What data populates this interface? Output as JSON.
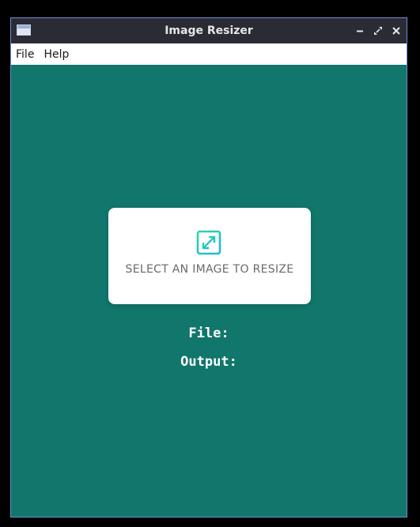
{
  "window": {
    "title": "Image Resizer"
  },
  "menubar": {
    "items": [
      {
        "label": "File"
      },
      {
        "label": "Help"
      }
    ]
  },
  "card": {
    "label": "SELECT AN IMAGE TO RESIZE",
    "icon": "expand-arrows-icon"
  },
  "info": {
    "file_label": "File:",
    "file_value": "",
    "output_label": "Output:",
    "output_value": ""
  },
  "colors": {
    "background": "#11766c",
    "titlebar": "#2b2b35",
    "window_border": "#6b8fd6",
    "icon_gradient_start": "#2dd6a8",
    "icon_gradient_end": "#1fb6e0"
  }
}
